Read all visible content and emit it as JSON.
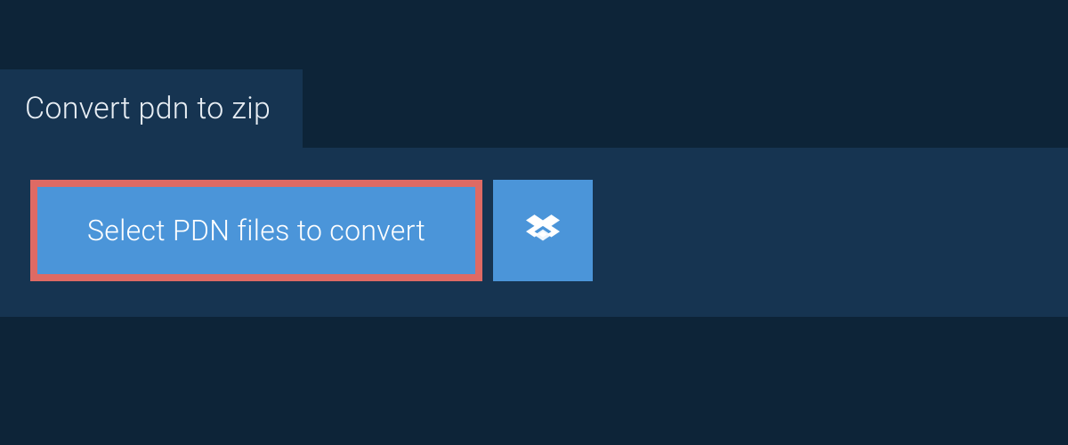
{
  "tab": {
    "title": "Convert pdn to zip"
  },
  "main": {
    "select_button_label": "Select PDN files to convert"
  }
}
